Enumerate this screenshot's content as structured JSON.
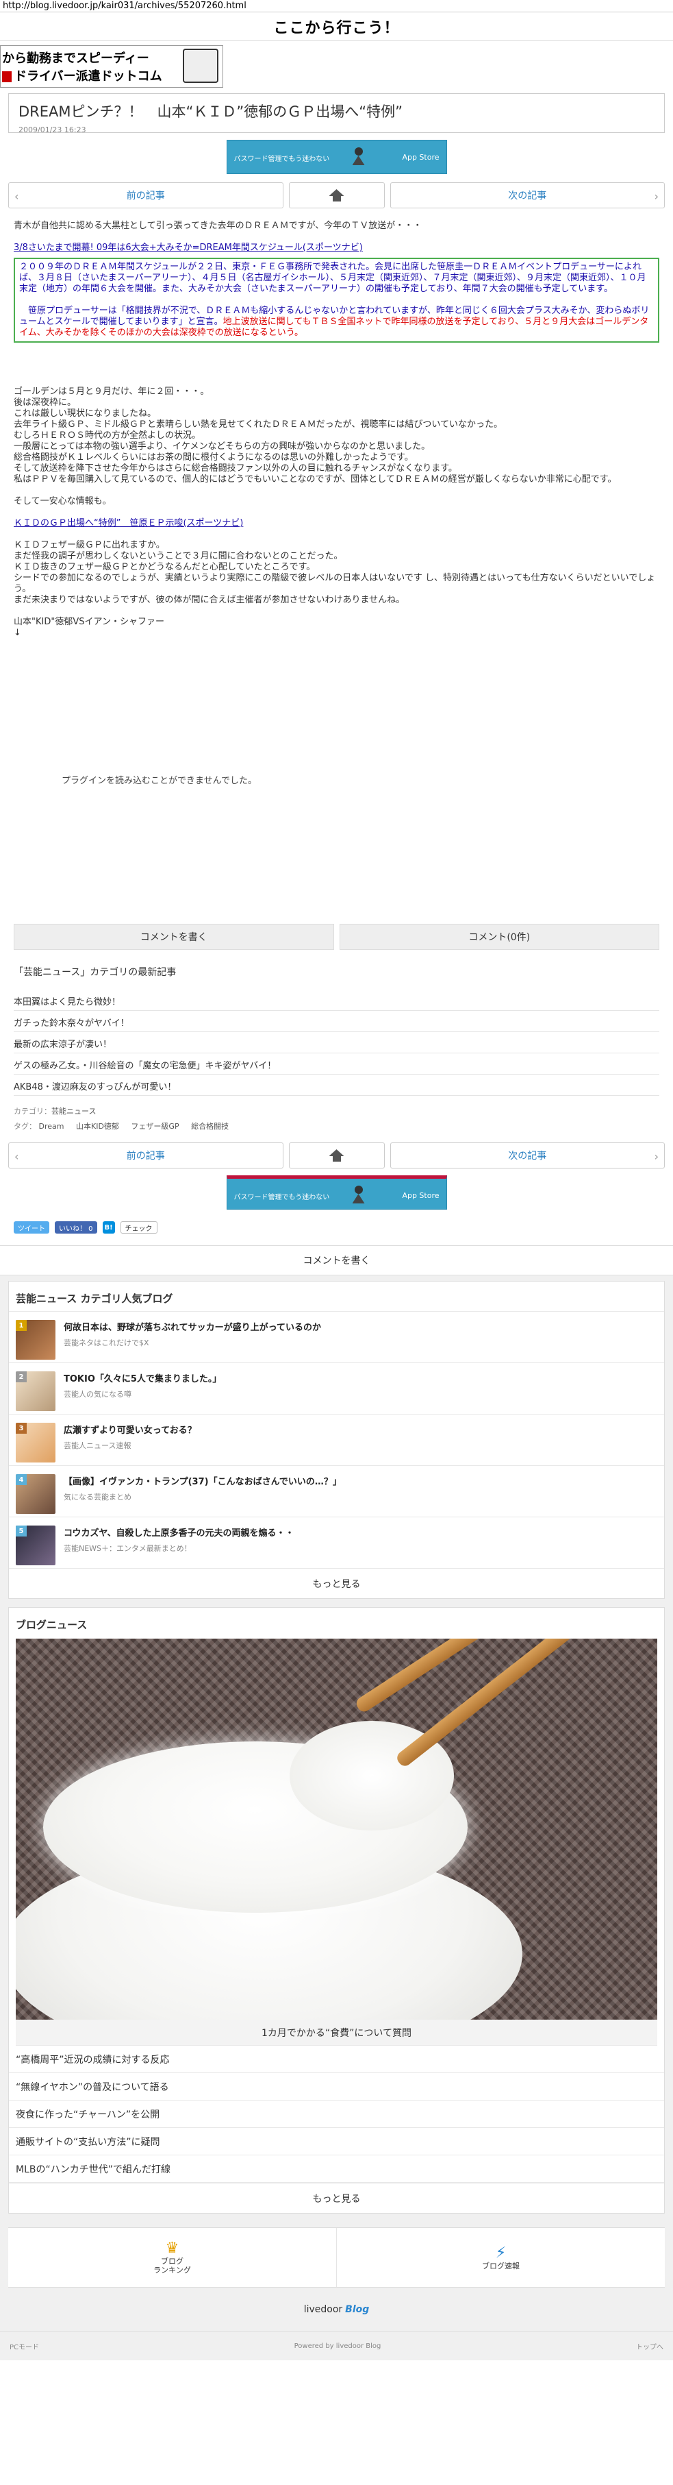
{
  "browser": {
    "url": "http://blog.livedoor.jp/kair031/archives/55207260.html"
  },
  "site": {
    "title": "ここから行こう！"
  },
  "top_banner": {
    "line1": "から勤務までスピーディー",
    "line2": "ドライバー派遣ドットコム"
  },
  "article": {
    "title": "DREAMピンチ？！　山本“ＫＩＤ”徳郁のＧＰ出場へ“特例”",
    "date": "2009/01/23 16:23",
    "intro": "青木が自他共に認める大黒柱として引っ張ってきた去年のＤＲＥＡＭですが、今年のＴＶ放送が・・・",
    "link1": "3/8さいたまで開幕! 09年は6大会+大みそか=DREAM年間スケジュール(スポーツナビ)",
    "box_text": "２００９年のＤＲＥＡＭ年間スケジュールが２２日、東京・ＦＥＧ事務所で発表された。会見に出席した笹原圭一ＤＲＥＡＭイベントプロデューサーによれば、３月８日（さいたまスーパーアリーナ）、４月５日（名古屋ガイシホール）、５月末定（関東近郊）、７月末定（関東近郊）、９月末定（関東近郊）、１０月末定（地方）の年間６大会を開催。また、大みそか大会（さいたまスーパーアリーナ）の開催も予定しており、年間７大会の開催も予定しています。",
    "box_text2": "　笹原プロデューサーは「格闘技界が不況で、ＤＲＥＡＭも縮小するんじゃないかと言われていますが、昨年と同じく６回大会プラス大みそか、変わらぬボリュームとスケールで開催してまいります」と宣言。",
    "box_red": "地上波放送に関してもＴＢＳ全国ネットで昨年同様の放送を予定しており、５月と９月大会はゴールデンタイム、大みそかを除くそのほかの大会は深夜枠での放送になるという。",
    "p1": [
      "ゴールデンは５月と９月だけ、年に２回・・・。",
      "後は深夜枠に。",
      "これは厳しい現状になりましたね。",
      "去年ライト級ＧＰ、ミドル級ＧＰと素晴らしい熱を見せてくれたＤＲＥＡＭだったが、視聴率には結びついていなかった。",
      "むしろＨＥＲＯＳ時代の方が全然よしの状況。",
      "一般層にとっては本物の強い選手より、イケメンなどそちらの方の興味が強いからなのかと思いました。",
      "総合格闘技がＫ１レベルくらいにはお茶の間に根付くようになるのは思いの外難しかったようです。",
      "そして放送枠を降下させた今年からはさらに総合格闘技ファン以外の人の目に触れるチャンスがなくなります。",
      "私はＰＰＶを毎回購入して見ているので、個人的にはどうでもいいことなのですが、団体としてＤＲＥＡＭの経営が厳しくならないか非常に心配です。"
    ],
    "p2": "そして一安心な情報も。",
    "link2": "ＫＩＤのＧＰ出場へ“特例”　笹原ＥＰ示唆(スポーツナビ)",
    "p3": [
      "ＫＩＤフェザー級ＧＰに出れますか。",
      "まだ怪我の調子が思わしくないということで３月に間に合わないとのことだった。",
      "ＫＩＤ抜きのフェザー級ＧＰとかどうなるんだと心配していたところです。",
      "シードでの参加になるのでしょうが、実績というより実際にこの階級で彼レベルの日本人はいないです し、特別待遇とはいっても仕方ないくらいだといいでしょう。",
      "まだ未決まりではないようですが、彼の体が間に合えば主催者が参加させないわけありませんね。"
    ],
    "video_caption": "山本\"KID\"徳郁VSイアン・シャファー",
    "video_arrow": "↓",
    "plugin_msg": "プラグインを読み込むことができませんでした。"
  },
  "app_ad": {
    "text": "パスワード管理でもう迷わない",
    "store": "App Store"
  },
  "pager": {
    "prev": "前の記事",
    "next": "次の記事"
  },
  "comments": {
    "write": "コメントを書く",
    "count": "コメント(0件)"
  },
  "category_latest": {
    "heading": "「芸能ニュース」カテゴリの最新記事",
    "items": [
      "本田翼はよく見たら微妙！",
      "ガチった鈴木奈々がヤバイ！",
      "最新の広末涼子が凄い！",
      "ゲスの極み乙女。・川谷絵音の「魔女の宅急便」キキ姿がヤバイ！",
      "AKB48・渡辺麻友のすっぴんが可愛い！"
    ]
  },
  "meta": {
    "category_label": "カテゴリ：",
    "category": "芸能ニュース",
    "tag_label": "タグ：",
    "tags": [
      "Dream",
      "山本KID徳郁",
      "フェザー級GP",
      "総合格闘技"
    ]
  },
  "social": {
    "tweet": "ツイート",
    "like": "いいね！ 0",
    "hatena": "B!",
    "check": "チェック"
  },
  "popular": {
    "heading": "芸能ニュース カテゴリ人気ブログ",
    "items": [
      {
        "rank": "1",
        "title": "何故日本は、野球が落ちぶれてサッカーが盛り上がっているのか",
        "source": "芸能ネタはこれだけで$X"
      },
      {
        "rank": "2",
        "title": "TOKIO「久々に5人で集まりました。」",
        "source": "芸能人の気になる噂"
      },
      {
        "rank": "3",
        "title": "広瀬すずより可愛い女っておる？",
        "source": "芸能人ニュース速報"
      },
      {
        "rank": "4",
        "title": "【画像】イヴァンカ・トランプ(37)「こんなおばさんでいいの…？」",
        "source": "気になる芸能まとめ"
      },
      {
        "rank": "5",
        "title": "コウカズヤ、自殺した上原多香子の元夫の両親を煽る・・",
        "source": "芸能NEWS＋：エンタメ最新まとめ！"
      }
    ],
    "more": "もっと見る"
  },
  "blog_news": {
    "heading": "ブログニュース",
    "caption": "1カ月でかかる“食費”について質問",
    "items": [
      "“高橋周平”近況の成績に対する反応",
      "“無線イヤホン”の普及について語る",
      "夜食に作った“チャーハン”を公開",
      "通販サイトの“支払い方法”に疑問",
      "MLBの“ハンカチ世代”で組んだ打線"
    ],
    "more": "もっと見る"
  },
  "footer": {
    "ranking": "ブログ\nランキング",
    "ranking_l1": "ブログ",
    "ranking_l2": "ランキング",
    "bulletin": "ブログ速報",
    "logo": "livedoor",
    "logo_b": "Blog",
    "pc_mode": "PCモード",
    "powered": "Powered by livedoor Blog",
    "top": "トップへ"
  }
}
